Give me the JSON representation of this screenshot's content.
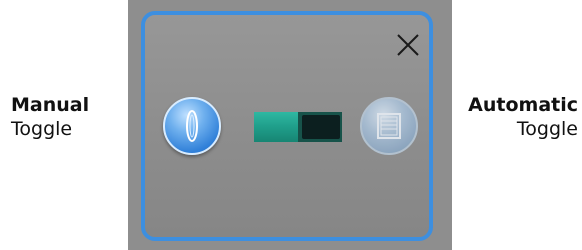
{
  "left_label": {
    "title": "Manual",
    "subtitle": "Toggle"
  },
  "right_label": {
    "title": "Automatic",
    "subtitle": "Toggle"
  },
  "dialog": {
    "close_icon": "close-icon",
    "manual_button_icon": "lens-icon",
    "automatic_button_icon": "window-icon",
    "switch_state": "automatic",
    "colors": {
      "border": "#3d8fe0",
      "background": "#8e8e8e",
      "switch_track": "#1f9e8a",
      "switch_knob": "#0c1f1f",
      "manual_button": "#2f7fd8",
      "automatic_button": "#a8bfd6"
    }
  }
}
